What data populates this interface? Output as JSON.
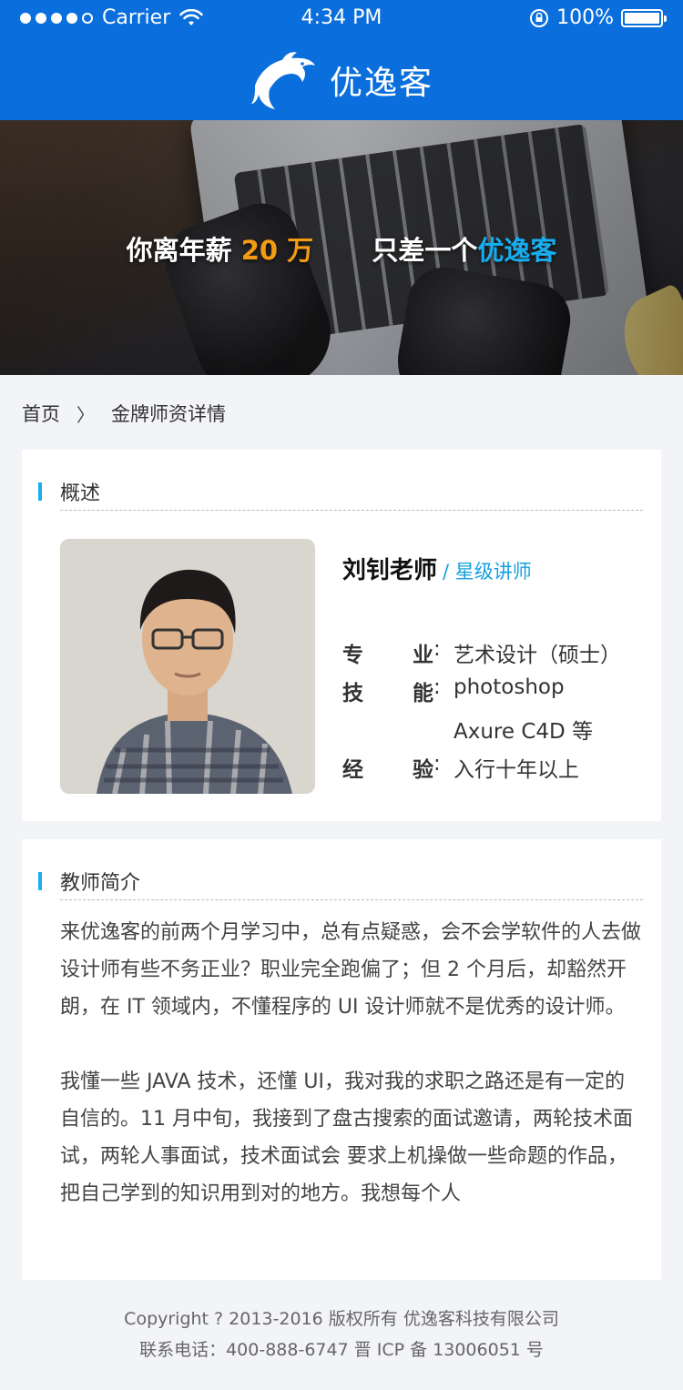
{
  "status_bar": {
    "carrier": "Carrier",
    "time": "4:34 PM",
    "battery": "100%"
  },
  "header": {
    "brand_name": "优逸客",
    "logo_icon": "dolphin-logo-icon",
    "background_color": "#0a6fdc"
  },
  "hero": {
    "line_part1": "你离年薪",
    "line_number": "20 万",
    "line_part2": "只差一个",
    "line_brand": "优逸客",
    "number_color": "#f29b13",
    "brand_color": "#16aef0"
  },
  "breadcrumb": {
    "home": "首页",
    "separator": "〉",
    "current": "金牌师资详情"
  },
  "overview": {
    "title": "概述",
    "teacher_name": "刘钊老师",
    "teacher_title": "/ 星级讲师",
    "major_label_1": "专",
    "major_label_2": "业",
    "major_value": "艺术设计（硕士）",
    "skills_label_1": "技",
    "skills_label_2": "能",
    "skills_value_1": "photoshop",
    "skills_value_2": "Axure  C4D 等",
    "exp_label_1": "经",
    "exp_label_2": "验",
    "exp_value": "入行十年以上",
    "colon": ":"
  },
  "intro": {
    "title": "教师简介",
    "paragraph_1": "来优逸客的前两个月学习中，总有点疑惑，会不会学软件的人去做设计师有些不务正业？职业完全跑偏了；但 2 个月后，却豁然开朗，在 IT 领域内，不懂程序的 UI 设计师就不是优秀的设计师。",
    "paragraph_2": "我懂一些 JAVA 技术，还懂 UI，我对我的求职之路还是有一定的自信的。11 月中旬，我接到了盘古搜索的面试邀请，两轮技术面试，两轮人事面试，技术面试会 要求上机操做一些命题的作品，把自己学到的知识用到对的地方。我想每个人"
  },
  "footer": {
    "copyright": "Copyright ? 2013-2016 版权所有 优逸客科技有限公司",
    "contact": "联系电话：400-888-6747 晋 ICP 备 13006051 号"
  }
}
